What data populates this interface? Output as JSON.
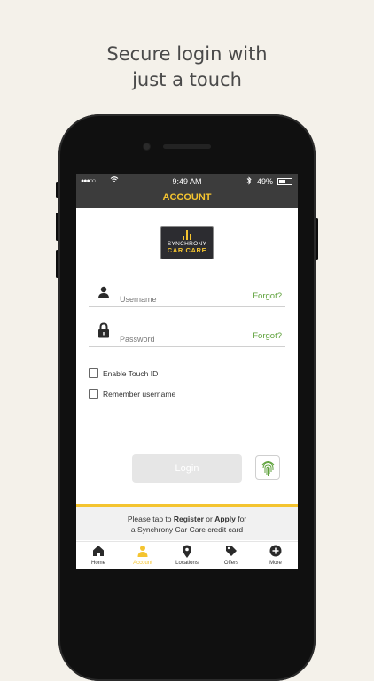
{
  "headline": {
    "line1": "Secure login with",
    "line2": "just a touch"
  },
  "status_bar": {
    "signal": "●●●○○",
    "time": "9:49 AM",
    "battery": "49%"
  },
  "nav": {
    "title": "ACCOUNT"
  },
  "logo": {
    "line1": "SYNCHRONY",
    "line2": "CAR CARE"
  },
  "form": {
    "username_placeholder": "Username",
    "password_placeholder": "Password",
    "forgot_label": "Forgot?",
    "touch_id_label": "Enable Touch ID",
    "remember_label": "Remember username",
    "login_label": "Login"
  },
  "promo": {
    "prefix": "Please tap to",
    "register": "Register",
    "or": "or",
    "apply": "Apply",
    "suffix_1": "for",
    "line2": "a Synchrony Car Care credit card"
  },
  "tabs": [
    {
      "label": "Home",
      "icon": "home-icon"
    },
    {
      "label": "Account",
      "icon": "person-icon"
    },
    {
      "label": "Locations",
      "icon": "location-pin-icon"
    },
    {
      "label": "Offers",
      "icon": "tag-icon"
    },
    {
      "label": "More",
      "icon": "plus-circle-icon"
    }
  ],
  "colors": {
    "accent": "#f4c430",
    "link_green": "#5fa23c",
    "dark_bar": "#3c3c3c"
  }
}
